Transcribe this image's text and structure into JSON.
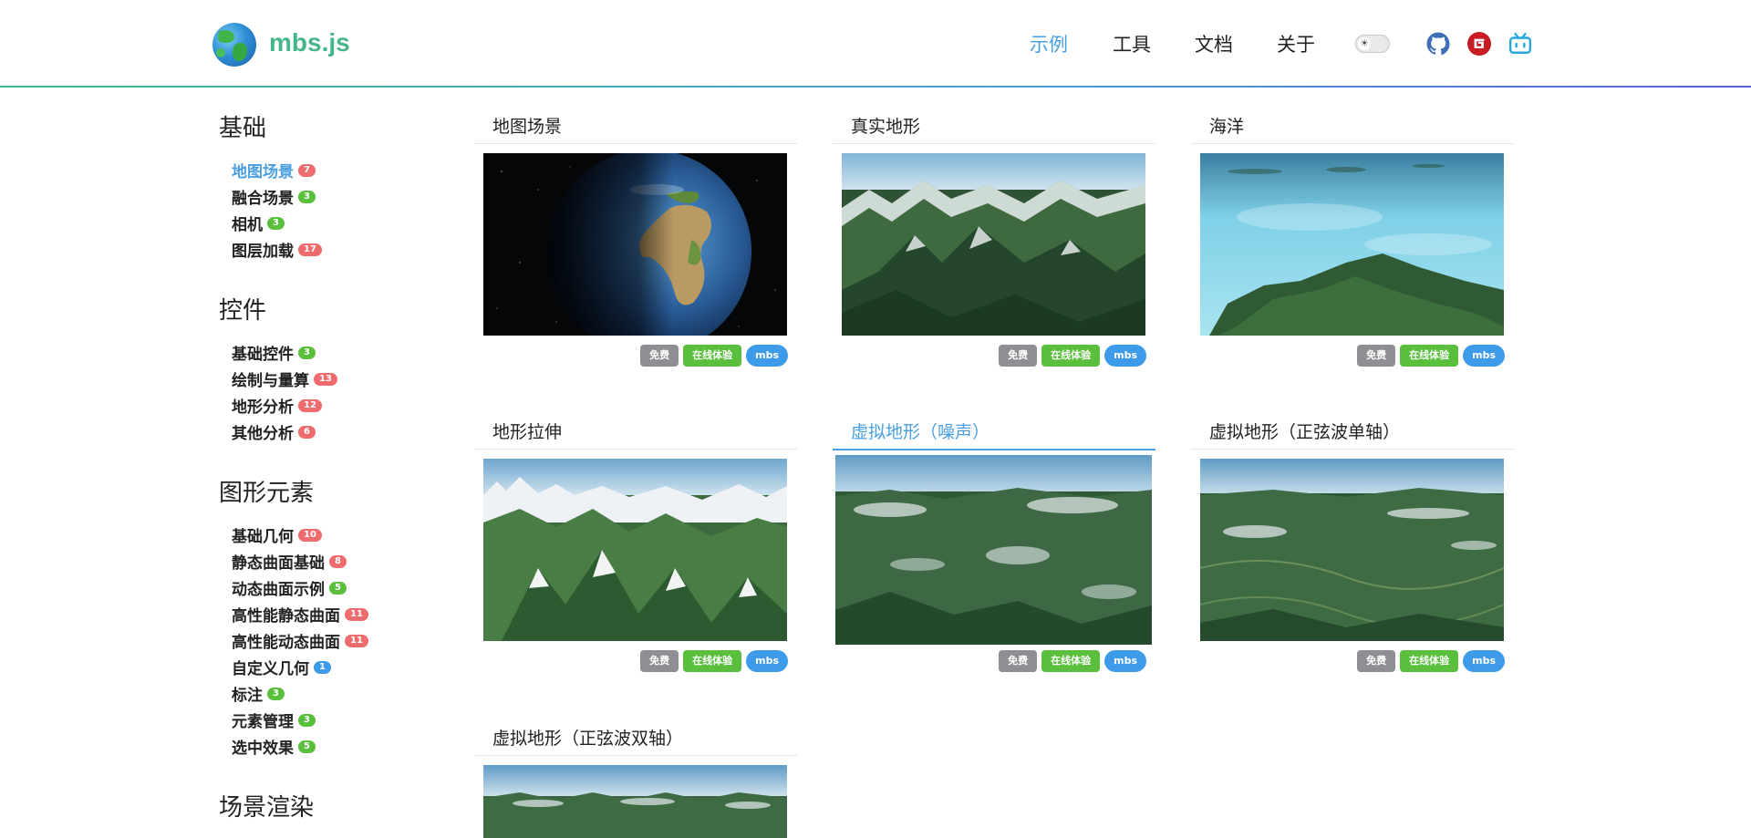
{
  "brand": {
    "name": "mbs.js"
  },
  "nav": {
    "items": [
      "示例",
      "工具",
      "文档",
      "关于"
    ],
    "active_index": 0
  },
  "social": {
    "icons": [
      "github-icon",
      "gitee-icon",
      "bilibili-icon"
    ]
  },
  "sidebar": {
    "sections": [
      {
        "title": "基础",
        "items": [
          {
            "label": "地图场景",
            "count": "7",
            "color": "red"
          },
          {
            "label": "融合场景",
            "count": "3",
            "color": "green"
          },
          {
            "label": "相机",
            "count": "3",
            "color": "green"
          },
          {
            "label": "图层加载",
            "count": "17",
            "color": "red"
          }
        ]
      },
      {
        "title": "控件",
        "items": [
          {
            "label": "基础控件",
            "count": "3",
            "color": "green"
          },
          {
            "label": "绘制与量算",
            "count": "13",
            "color": "red"
          },
          {
            "label": "地形分析",
            "count": "12",
            "color": "red"
          },
          {
            "label": "其他分析",
            "count": "6",
            "color": "red"
          }
        ]
      },
      {
        "title": "图形元素",
        "items": [
          {
            "label": "基础几何",
            "count": "10",
            "color": "red"
          },
          {
            "label": "静态曲面基础",
            "count": "8",
            "color": "red"
          },
          {
            "label": "动态曲面示例",
            "count": "5",
            "color": "green"
          },
          {
            "label": "高性能静态曲面",
            "count": "11",
            "color": "red"
          },
          {
            "label": "高性能动态曲面",
            "count": "11",
            "color": "red"
          },
          {
            "label": "自定义几何",
            "count": "1",
            "color": "blue"
          },
          {
            "label": "标注",
            "count": "3",
            "color": "green"
          },
          {
            "label": "元素管理",
            "count": "3",
            "color": "green"
          },
          {
            "label": "选中效果",
            "count": "5",
            "color": "green"
          }
        ]
      },
      {
        "title": "场景渲染",
        "items": []
      }
    ],
    "active": "地图场景"
  },
  "cards": [
    {
      "title": "地图场景",
      "thumb": "earth"
    },
    {
      "title": "真实地形",
      "thumb": "mountains"
    },
    {
      "title": "海洋",
      "thumb": "ocean"
    },
    {
      "title": "地形拉伸",
      "thumb": "alps"
    },
    {
      "title": "虚拟地形（噪声）",
      "thumb": "terrain",
      "active": true
    },
    {
      "title": "虚拟地形（正弦波单轴）",
      "thumb": "terrain2"
    },
    {
      "title": "虚拟地形（正弦波双轴）",
      "thumb": "terrain3"
    }
  ],
  "tags": {
    "free": "免费",
    "online": "在线体验",
    "lib": "mbs"
  },
  "colors": {
    "accent": "#4a9fe0",
    "brand": "#45b58a",
    "badge_red": "#ee6b6e",
    "badge_green": "#5bbf3e",
    "badge_blue": "#3d9be9"
  }
}
